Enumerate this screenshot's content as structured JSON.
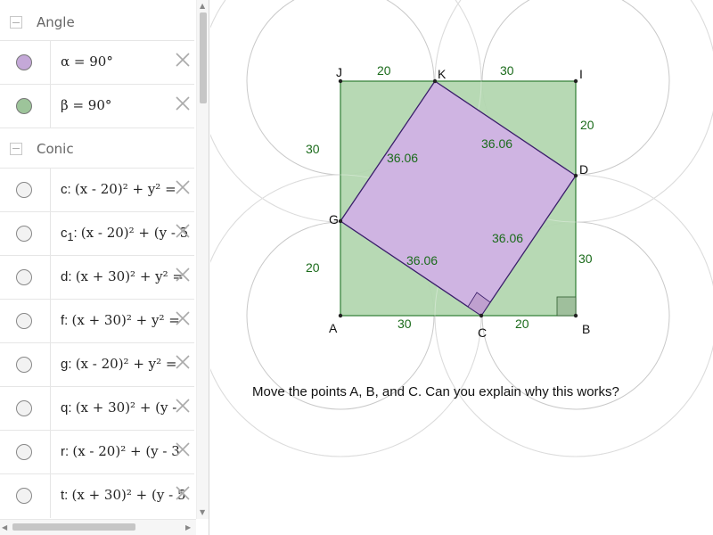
{
  "algebra": {
    "groups": [
      {
        "title": "Angle"
      },
      {
        "title": "Conic"
      }
    ],
    "angles": [
      {
        "name": "α",
        "value": "90°",
        "color": "#c4a8d8"
      },
      {
        "name": "β",
        "value": "90°",
        "color": "#9dc49a"
      }
    ],
    "conics": [
      {
        "name": "c",
        "sub": "",
        "equation": "(x - 20)² + y² = "
      },
      {
        "name": "c",
        "sub": "1",
        "equation": "(x - 20)² + (y - 5"
      },
      {
        "name": "d",
        "sub": "",
        "equation": "(x + 30)² + y² ="
      },
      {
        "name": "f",
        "sub": "",
        "equation": "(x + 30)² + y² ="
      },
      {
        "name": "g",
        "sub": "",
        "equation": "(x - 20)² + y² ="
      },
      {
        "name": "q",
        "sub": "",
        "equation": "(x + 30)² + (y -"
      },
      {
        "name": "r",
        "sub": "",
        "equation": "(x - 20)² + (y - 3"
      },
      {
        "name": "t",
        "sub": "",
        "equation": "(x + 30)² + (y - 5"
      }
    ]
  },
  "geometry": {
    "points": {
      "A": "A",
      "B": "B",
      "C": "C",
      "D": "D",
      "G": "G",
      "I": "I",
      "J": "J",
      "K": "K"
    },
    "side_labels": {
      "JK": "20",
      "KI": "30",
      "ID": "20",
      "DB": "30",
      "BC": "20",
      "CA": "30",
      "AG": "20",
      "GJ": "30",
      "KD": "36.06",
      "GK": "36.06",
      "DC": "36.06",
      "GC": "36.06"
    },
    "colors": {
      "square_fill": "#b3d7b0",
      "square_stroke": "#2e7d32",
      "inner_fill": "#cfb4e2",
      "inner_stroke": "#3b1f6b",
      "label_color": "#1b6b1b",
      "circle_stroke": "#c9c9c9"
    }
  },
  "caption": "Move the points A, B, and C. Can you explain why this works?"
}
